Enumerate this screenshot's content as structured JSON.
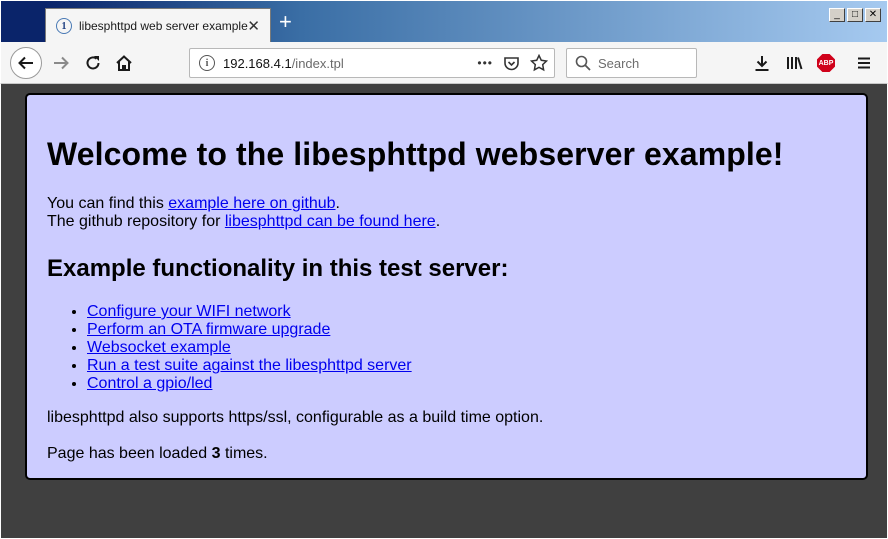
{
  "browser": {
    "tab": {
      "title": "libesphttpd web server example",
      "close": "✕"
    },
    "new_tab": "+",
    "window_buttons": [
      "_",
      "□",
      "✕"
    ],
    "url": {
      "host": "192.168.4.1",
      "path": "/index.tpl"
    },
    "url_more": "•••",
    "search_placeholder": "Search",
    "abp_label": "ABP"
  },
  "page": {
    "heading": "Welcome to the libesphttpd webserver example!",
    "intro": {
      "line1_prefix": "You can find this ",
      "line1_link": "example here on github",
      "line1_suffix": ".",
      "line2_prefix": "The github repository for ",
      "line2_link": "libesphttpd can be found here",
      "line2_suffix": "."
    },
    "subheading": "Example functionality in this test server:",
    "links": [
      "Configure your WIFI network",
      "Perform an OTA firmware upgrade",
      "Websocket example",
      "Run a test suite against the libesphttpd server",
      "Control a gpio/led"
    ],
    "ssl_text": "libesphttpd also supports https/ssl, configurable as a build time option.",
    "loaded": {
      "prefix": "Page has been loaded ",
      "count": "3",
      "suffix": " times."
    }
  },
  "colors": {
    "card_bg": "#ccccff",
    "link": "#0000ee",
    "viewport_bg": "#404040",
    "titlebar": "#0a246a"
  },
  "icons": [
    "tab-favicon",
    "back-arrow-icon",
    "forward-arrow-icon",
    "reload-icon",
    "home-icon",
    "info-icon",
    "page-actions-icon",
    "pocket-icon",
    "bookmark-star-icon",
    "search-icon",
    "download-icon",
    "library-icon",
    "adblock-icon",
    "menu-icon"
  ]
}
